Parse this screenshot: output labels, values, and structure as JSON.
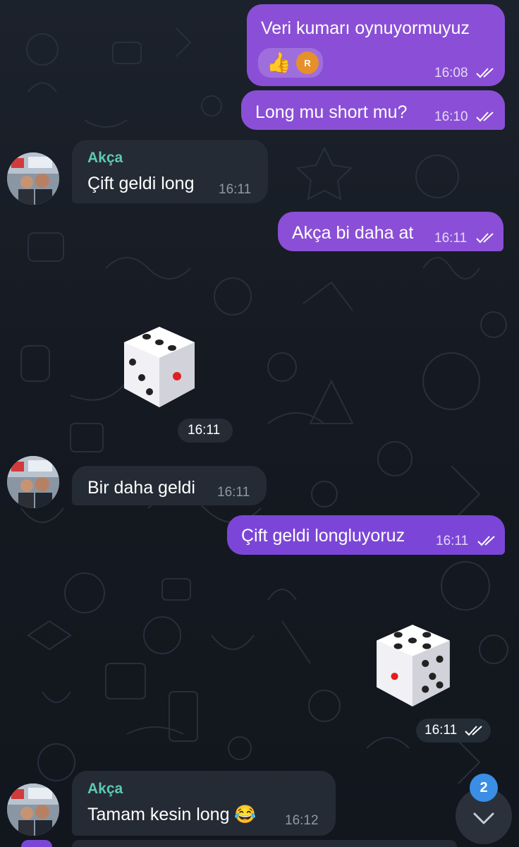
{
  "messages": [
    {
      "id": "m1",
      "dir": "out",
      "text": "Veri kumarı oynuyormuyuz",
      "time": "16:08",
      "reactions": [
        {
          "emoji": "👍",
          "badge": "R"
        }
      ]
    },
    {
      "id": "m2",
      "dir": "out",
      "text": "Long mu short mu?",
      "time": "16:10"
    },
    {
      "id": "m3",
      "dir": "in",
      "sender": "Akça",
      "text": "Çift geldi long",
      "time": "16:11"
    },
    {
      "id": "m4",
      "dir": "out",
      "text": "Akça bi daha at",
      "time": "16:11"
    },
    {
      "id": "m5",
      "dir": "in",
      "type": "dice",
      "value": 3,
      "time": "16:11"
    },
    {
      "id": "m6",
      "dir": "in",
      "text": "Bir daha geldi",
      "time": "16:11"
    },
    {
      "id": "m7",
      "dir": "out",
      "text": "Çift geldi longluyoruz",
      "time": "16:11"
    },
    {
      "id": "m8",
      "dir": "out",
      "type": "dice",
      "value": 5,
      "time": "16:11"
    },
    {
      "id": "m9",
      "dir": "in",
      "sender": "Akça",
      "text": "Tamam kesin long 😂",
      "time": "16:12"
    }
  ],
  "scroll_down": {
    "unread_count": "2"
  },
  "colors": {
    "outgoing": "#8a4fd6",
    "incoming": "#242b35",
    "sender_name": "#5ec8b4",
    "unread_badge": "#3a8ee6"
  }
}
